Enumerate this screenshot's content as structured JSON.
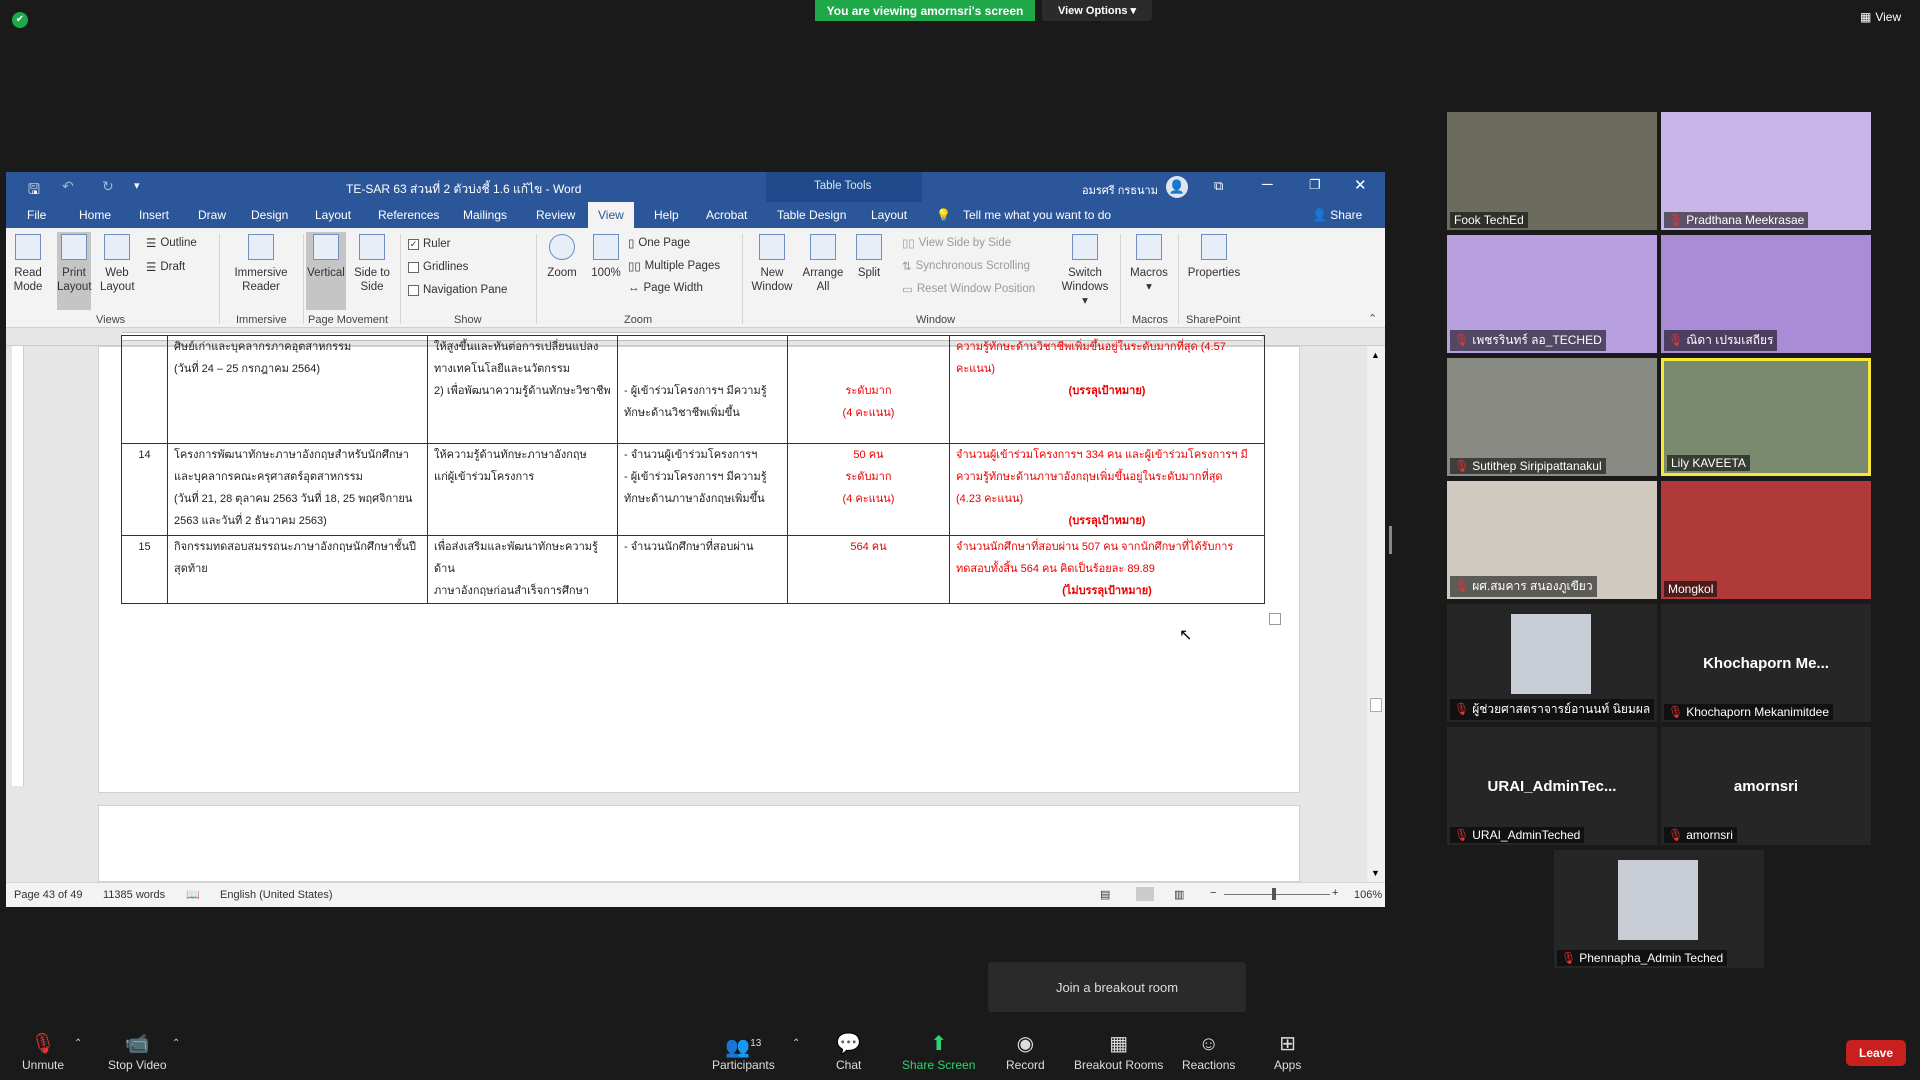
{
  "zoom": {
    "banner": "You are viewing amornsri's screen",
    "view_options": "View Options",
    "top_view": "View",
    "breakout": "Join a breakout room",
    "leave": "Leave"
  },
  "word": {
    "title": "TE-SAR 63 ส่วนที่ 2 ตัวบ่งชี้ 1.6 แก้ไข  -  Word",
    "table_tools": "Table Tools",
    "user": "อมรศรี กรธนาม",
    "tabs": [
      "File",
      "Home",
      "Insert",
      "Draw",
      "Design",
      "Layout",
      "References",
      "Mailings",
      "Review",
      "View",
      "Help",
      "Acrobat",
      "Table Design",
      "Layout"
    ],
    "tell_me": "Tell me what you want to do",
    "share": "Share",
    "ribbon": {
      "read_mode": "Read Mode",
      "print_layout": "Print Layout",
      "web_layout": "Web Layout",
      "outline": "Outline",
      "draft": "Draft",
      "views": "Views",
      "immersive_reader": "Immersive Reader",
      "immersive": "Immersive",
      "vertical": "Vertical",
      "side_to_side": "Side to Side",
      "page_movement": "Page Movement",
      "ruler": "Ruler",
      "gridlines": "Gridlines",
      "navigation_pane": "Navigation Pane",
      "show": "Show",
      "zoom": "Zoom",
      "hundred": "100%",
      "one_page": "One Page",
      "multiple_pages": "Multiple Pages",
      "page_width": "Page Width",
      "zoom_group": "Zoom",
      "new_window": "New Window",
      "arrange_all": "Arrange All",
      "split": "Split",
      "view_side": "View Side by Side",
      "sync_scroll": "Synchronous Scrolling",
      "reset_pos": "Reset Window Position",
      "switch_windows": "Switch Windows",
      "window": "Window",
      "macros": "Macros",
      "macros_group": "Macros",
      "properties": "Properties",
      "sharepoint": "SharePoint"
    },
    "status": {
      "page": "Page 43 of 49",
      "words": "11385 words",
      "lang": "English (United States)",
      "zoom": "106%"
    }
  },
  "doc_rows": [
    {
      "no": "",
      "c1": [
        "ศิษย์เก่าและบุคลากรภาคอุตสาหกรรม",
        "(วันที่ 24 – 25 กรกฎาคม 2564)"
      ],
      "c2": [
        "ให้สูงขึ้นและทันต่อการเปลี่ยนแปลง",
        "ทางเทคโนโลยีและนวัตกรรม",
        "2) เพื่อพัฒนาความรู้ด้านทักษะวิชาชีพ"
      ],
      "c3": [
        "",
        "",
        "- ผู้เข้าร่วมโครงการฯ มีความรู้",
        "ทักษะด้านวิชาชีพเพิ่มขึ้น"
      ],
      "c4": [
        "",
        "",
        "ระดับมาก",
        "(4 คะแนน)"
      ],
      "c5": [
        "ความรู้ทักษะด้านวิชาชีพเพิ่มขึ้นอยู่ในระดับมากที่สุด (4.57 คะแนน)"
      ],
      "c5b": "(บรรลุเป้าหมาย)"
    },
    {
      "no": "14",
      "c1": [
        "โครงการพัฒนาทักษะภาษาอังกฤษสำหรับนักศึกษา",
        "และบุคลากรคณะครุศาสตร์อุตสาหกรรม",
        "(วันที่ 21, 28 ตุลาคม 2563 วันที่ 18, 25 พฤศจิกายน",
        "2563 และวันที่ 2 ธันวาคม 2563)"
      ],
      "c2": [
        "ให้ความรู้ด้านทักษะภาษาอังกฤษ",
        "แก่ผู้เข้าร่วมโครงการ"
      ],
      "c3": [
        "- จำนวนผู้เข้าร่วมโครงการฯ",
        "- ผู้เข้าร่วมโครงการฯ มีความรู้",
        "ทักษะด้านภาษาอังกฤษเพิ่มขึ้น"
      ],
      "c4": [
        "50 คน",
        "ระดับมาก",
        "(4 คะแนน)"
      ],
      "c5": [
        "จำนวนผู้เข้าร่วมโครงการฯ 334 คน และผู้เข้าร่วมโครงการฯ มี",
        "ความรู้ทักษะด้านภาษาอังกฤษเพิ่มขึ้นอยู่ในระดับมากที่สุด",
        "(4.23 คะแนน)"
      ],
      "c5b": "(บรรลุเป้าหมาย)"
    },
    {
      "no": "15",
      "c1": [
        "กิจกรรมทดสอบสมรรถนะภาษาอังกฤษนักศึกษาชั้นปี",
        "สุดท้าย"
      ],
      "c2": [
        "เพื่อส่งเสริมและพัฒนาทักษะความรู้ด้าน",
        "ภาษาอังกฤษก่อนสำเร็จการศึกษา"
      ],
      "c3": [
        "- จำนวนนักศึกษาที่สอบผ่าน"
      ],
      "c4": [
        "564 คน"
      ],
      "c5": [
        "จำนวนนักศึกษาที่สอบผ่าน 507 คน จากนักศึกษาที่ได้รับการ",
        "ทดสอบทั้งสิ้น 564 คน คิดเป็นร้อยละ 89.89"
      ],
      "c5b": "(ไม่บรรลุเป้าหมาย)"
    }
  ],
  "participants": [
    {
      "name": "Fook TechEd",
      "video": true,
      "muted": false,
      "color": "#6b6b5e"
    },
    {
      "name": "Pradthana Meekrasae",
      "video": true,
      "muted": true,
      "color": "#c9b6e8"
    },
    {
      "name": "เพชรรินทร์ ลอ_TECHED",
      "video": true,
      "muted": true,
      "color": "#b79fe0"
    },
    {
      "name": "ณิดา เปรมเสถียร",
      "video": true,
      "muted": true,
      "color": "#a98bd6"
    },
    {
      "name": "Sutithep Siripipattanakul",
      "video": true,
      "muted": true,
      "color": "#8a8a84"
    },
    {
      "name": "Lily KAVEETA",
      "video": true,
      "muted": false,
      "color": "#7a8a6e",
      "active": true
    },
    {
      "name": "ผศ.สมคาร สนองภูเขียว",
      "video": true,
      "muted": true,
      "color": "#cfc9c0"
    },
    {
      "name": "Mongkol",
      "video": true,
      "muted": false,
      "color": "#b03a3a"
    },
    {
      "name": "ผู้ช่วยศาสตราจารย์อานนท์ นิยมผล",
      "video": false,
      "muted": true,
      "photo": true
    },
    {
      "name": "Khochaporn Mekanimitdee",
      "video": false,
      "muted": true,
      "big": "Khochaporn  Me..."
    },
    {
      "name": "URAI_AdminTeched",
      "video": false,
      "muted": true,
      "big": "URAI_AdminTec..."
    },
    {
      "name": "amornsri",
      "video": false,
      "muted": true,
      "big": "amornsri"
    },
    {
      "name": "Phennapha_Admin Teched",
      "video": false,
      "muted": true,
      "photo": true
    }
  ],
  "toolbar": {
    "unmute": "Unmute",
    "stop_video": "Stop Video",
    "participants": "Participants",
    "participants_count": "13",
    "chat": "Chat",
    "share_screen": "Share Screen",
    "record": "Record",
    "breakout_rooms": "Breakout Rooms",
    "reactions": "Reactions",
    "apps": "Apps"
  },
  "colors": {
    "word_blue": "#2b579a",
    "zoom_green": "#1fa84a",
    "leave_red": "#c8201e",
    "doc_red": "#e00000"
  }
}
